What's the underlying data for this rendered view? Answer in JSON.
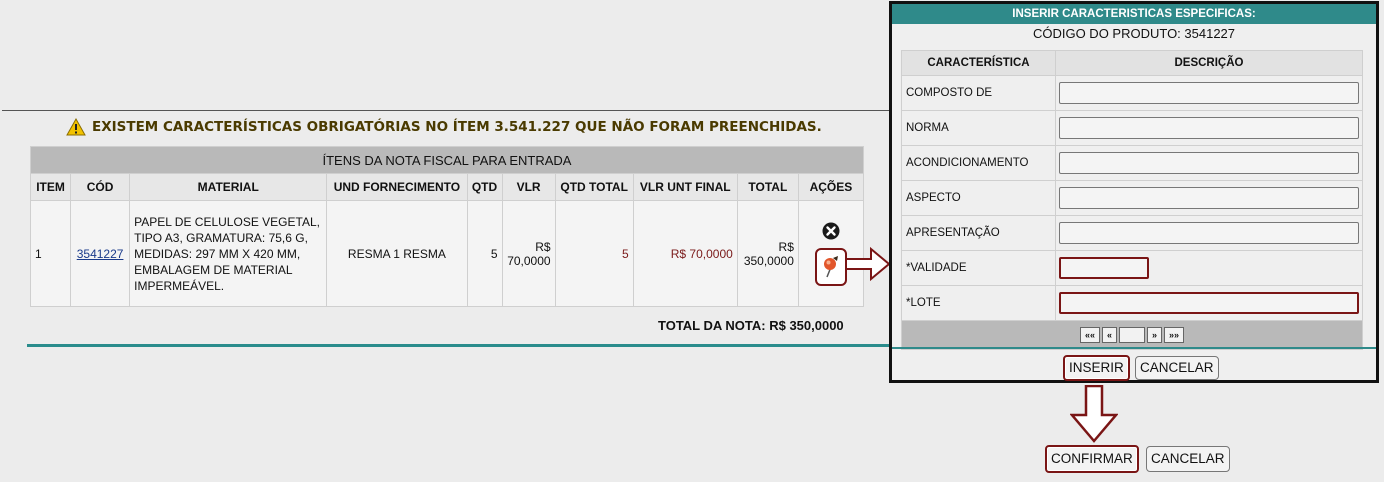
{
  "warning": {
    "text": "EXISTEM CARACTERÍSTICAS OBRIGATÓRIAS NO ÍTEM 3.541.227 QUE NÃO FORAM PREENCHIDAS."
  },
  "items_table": {
    "caption": "ÍTENS DA NOTA FISCAL PARA ENTRADA",
    "headers": [
      "ITEM",
      "CÓD",
      "MATERIAL",
      "UND FORNECIMENTO",
      "QTD",
      "VLR",
      "QTD TOTAL",
      "VLR UNT FINAL",
      "TOTAL",
      "AÇÕES"
    ],
    "rows": [
      {
        "item": "1",
        "cod": "3541227",
        "material": "PAPEL DE CELULOSE VEGETAL, TIPO A3, GRAMATURA: 75,6 G, MEDIDAS: 297 MM X 420 MM, EMBALAGEM DE MATERIAL IMPERMEÁVEL.",
        "und": "RESMA 1 RESMA",
        "qtd": "5",
        "vlr": "R$ 70,0000",
        "qtd_total": "5",
        "vlr_unt_final": "R$ 70,0000",
        "total": "R$ 350,0000"
      }
    ],
    "total_nota": "TOTAL DA NOTA: R$ 350,0000"
  },
  "dialog": {
    "title": "INSERIR CARACTERISTICAS ESPECIFICAS:",
    "product_code": "CÓDIGO DO PRODUTO: 3541227",
    "headers": [
      "CARACTERÍSTICA",
      "DESCRIÇÃO"
    ],
    "fields": [
      {
        "label": "COMPOSTO DE",
        "value": ""
      },
      {
        "label": "NORMA",
        "value": ""
      },
      {
        "label": "ACONDICIONAMENTO",
        "value": ""
      },
      {
        "label": "ASPECTO",
        "value": ""
      },
      {
        "label": "APRESENTAÇÃO",
        "value": ""
      },
      {
        "label": "*VALIDADE",
        "value": ""
      },
      {
        "label": "*LOTE",
        "value": ""
      }
    ],
    "pager": {
      "first": "««",
      "prev": "«",
      "next": "»",
      "last": "»»"
    },
    "insert_label": "INSERIR",
    "cancel_label": "CANCELAR"
  },
  "footer": {
    "confirm_label": "CONFIRMAR",
    "cancel_label": "CANCELAR"
  },
  "colors": {
    "teal": "#2f8a8a",
    "highlight": "#7a1515",
    "value_red": "#7a1a1a"
  }
}
